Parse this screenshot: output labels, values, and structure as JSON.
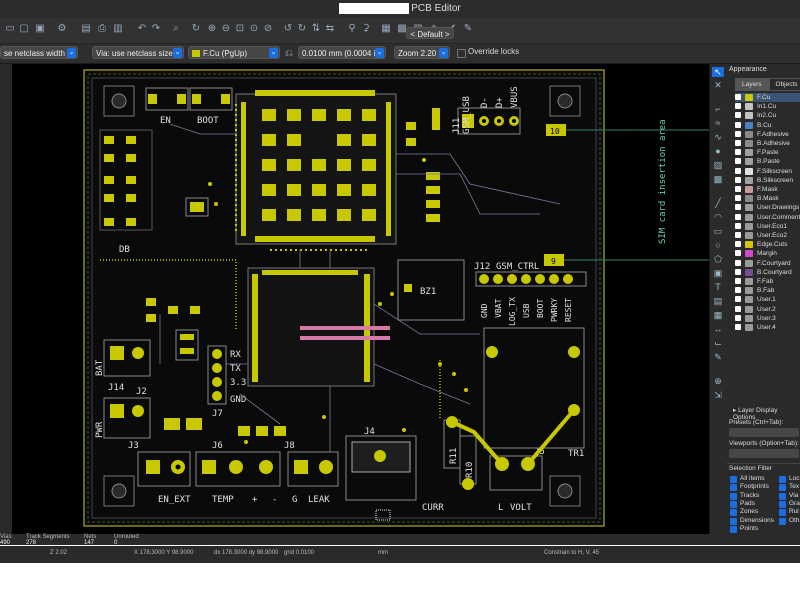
{
  "window": {
    "title": "PCB Editor"
  },
  "toolbar": {
    "track_width": "se netclass width",
    "via_size": "Via: use netclass sizes",
    "layer": "F.Cu (PgUp)",
    "grid": "0.0100 mm (0.0004 in)",
    "zoom": "Zoom 2.20",
    "override_locks": "Override locks",
    "preset": "< Default >"
  },
  "board": {
    "labels": {
      "en": "EN",
      "boot": "BOOT",
      "db": "DB",
      "bz1": "BZ1",
      "j12": "J12",
      "gsm_ctrl": "GSM_CTRL",
      "j11": "J11",
      "gsm_usb": "GSM_USB",
      "usb_pins": [
        "D-",
        "D+",
        "VBUS"
      ],
      "gsm_pins": [
        "GND",
        "VBAT",
        "LOG_TX",
        "USB",
        "BOOT",
        "PWRKY",
        "RESET"
      ],
      "j7": "J7",
      "j7_pins": [
        "RX",
        "TX",
        "3.3",
        "GND"
      ],
      "j14": "J14",
      "j2": "J2",
      "bat": "BAT",
      "pwr": "PWR",
      "j3": "J3",
      "j6": "J6",
      "j8": "J8",
      "j4": "J4",
      "j5": "J5",
      "tr1": "TR1",
      "r10": "R10",
      "r11": "R11",
      "curr": "CURR",
      "en_ext": "EN_EXT",
      "temp": "TEMP",
      "leak": "LEAK",
      "volt": "VOLT",
      "plus": "+",
      "minus": "-",
      "g": "G",
      "l": "L",
      "nine": "9",
      "ten": "10",
      "sim_area": "SIM card insertion area"
    }
  },
  "appearance": {
    "title": "Appearance",
    "tabs": [
      "Layers",
      "Objects"
    ],
    "layers": [
      {
        "name": "F.Cu",
        "color": "#c8c800"
      },
      {
        "name": "In1.Cu",
        "color": "#c2c2c2"
      },
      {
        "name": "In2.Cu",
        "color": "#c2c2c2"
      },
      {
        "name": "B.Cu",
        "color": "#4d7fc4"
      },
      {
        "name": "F.Adhesive",
        "color": "#8a8a8a"
      },
      {
        "name": "B.Adhesive",
        "color": "#8a8a8a"
      },
      {
        "name": "F.Paste",
        "color": "#a0a0a0"
      },
      {
        "name": "B.Paste",
        "color": "#a0a0a0"
      },
      {
        "name": "F.Silkscreen",
        "color": "#e0e0e0"
      },
      {
        "name": "B.Silkscreen",
        "color": "#a0a0a0"
      },
      {
        "name": "F.Mask",
        "color": "#c89a9a"
      },
      {
        "name": "B.Mask",
        "color": "#8a8a8a"
      },
      {
        "name": "User.Drawings",
        "color": "#9a9a9a"
      },
      {
        "name": "User.Comments",
        "color": "#9a9a9a"
      },
      {
        "name": "User.Eco1",
        "color": "#9a9a9a"
      },
      {
        "name": "User.Eco2",
        "color": "#9a9a9a"
      },
      {
        "name": "Edge.Cuts",
        "color": "#d4c600"
      },
      {
        "name": "Margin",
        "color": "#d04ad0"
      },
      {
        "name": "F.Courtyard",
        "color": "#9a9a9a"
      },
      {
        "name": "B.Courtyard",
        "color": "#7a4a9a"
      },
      {
        "name": "F.Fab",
        "color": "#9a9a9a"
      },
      {
        "name": "B.Fab",
        "color": "#9a9a9a"
      },
      {
        "name": "User.1",
        "color": "#9a9a9a"
      },
      {
        "name": "User.2",
        "color": "#9a9a9a"
      },
      {
        "name": "User.3",
        "color": "#9a9a9a"
      },
      {
        "name": "User.4",
        "color": "#9a9a9a"
      }
    ],
    "layer_display_options": "Layer Display Options",
    "presets_label": "Presets (Ctrl+Tab):",
    "viewports_label": "Viewports (Option+Tab):",
    "selection_filter": "Selection Filter",
    "filters_left": [
      "All items",
      "Footprints",
      "Tracks",
      "Pads",
      "Zones",
      "Dimensions",
      "Points"
    ],
    "filters_right": [
      "Loc",
      "Tex",
      "Via",
      "Gra",
      "Rul",
      "Oth"
    ]
  },
  "status": {
    "vias_label": "Vias",
    "vias": "490",
    "track_segments_label": "Track Segments",
    "track_segments": "278",
    "nets_label": "Nets",
    "nets": "147",
    "unrouted_label": "Unrouted",
    "unrouted": "0",
    "z": "Z 2.02",
    "xy": "X 178.3000  Y 98.9000",
    "dxdy": "dx 178.3000  dy 98.9000",
    "grid": "grid 0.0100",
    "units": "mm",
    "constrain": "Constrain to H, V, 45"
  }
}
